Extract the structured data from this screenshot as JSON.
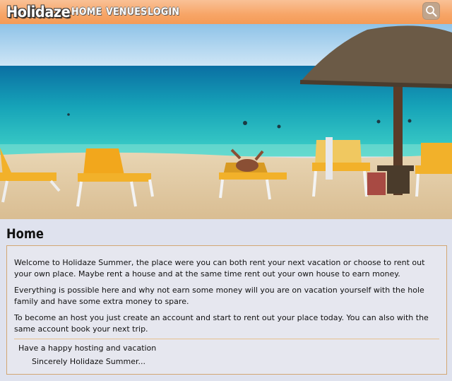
{
  "header": {
    "logo": "Holidaze",
    "nav": [
      {
        "label": "HOME"
      },
      {
        "label": "VENUES"
      },
      {
        "label": "LOGIN"
      }
    ],
    "search_icon": "search-icon"
  },
  "hero": {
    "image": "beach-with-sun-loungers-and-umbrella"
  },
  "main": {
    "title": "Home",
    "paragraphs": [
      "Welcome to Holidaze Summer, the place were you can both rent your next vacation or choose to rent out your own place. Maybe rent a house and at the same time rent out your own house to earn money.",
      "Everything is possible here and why not earn some money will you are on vacation yourself with the hole family and have some extra money to spare.",
      "To become an host you just create an account and start to rent out your place today. You can also with the same account book your next trip."
    ],
    "closing": "Have a happy hosting and vacation",
    "signature": "Sincerely Holidaze Summer..."
  },
  "colors": {
    "navbar": "#f7a567",
    "page_background": "#dfe2ee",
    "box_border": "#d3a773"
  }
}
